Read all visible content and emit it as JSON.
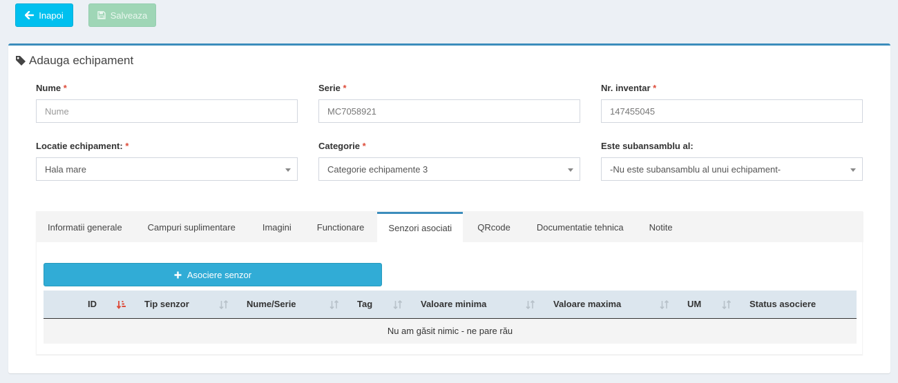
{
  "toolbar": {
    "back_label": "Inapoi",
    "save_label": "Salveaza"
  },
  "box": {
    "title": "Adauga echipament"
  },
  "form": {
    "nume": {
      "label": "Nume",
      "required": "*",
      "placeholder": "Nume",
      "value": ""
    },
    "serie": {
      "label": "Serie",
      "required": "*",
      "value": "MC7058921"
    },
    "inventar": {
      "label": "Nr. inventar",
      "required": "*",
      "value": "147455045"
    },
    "locatie": {
      "label": "Locatie echipament:",
      "required": "*",
      "value": "Hala mare"
    },
    "categorie": {
      "label": "Categorie",
      "required": "*",
      "value": "Categorie echipamente 3"
    },
    "subansamblu": {
      "label": "Este subansamblu al:",
      "value": "-Nu este subansamblu al unui echipament-"
    }
  },
  "tabs": [
    {
      "label": "Informatii generale"
    },
    {
      "label": "Campuri suplimentare"
    },
    {
      "label": "Imagini"
    },
    {
      "label": "Functionare"
    },
    {
      "label": "Senzori asociati",
      "active": true
    },
    {
      "label": "QRcode"
    },
    {
      "label": "Documentatie tehnica"
    },
    {
      "label": "Notite"
    }
  ],
  "sensors": {
    "associate_label": "Asociere senzor",
    "columns": [
      "ID",
      "Tip senzor",
      "Nume/Serie",
      "Tag",
      "Valoare minima",
      "Valoare maxima",
      "UM",
      "Status asociere"
    ],
    "empty_message": "Nu am găsit nimic - ne pare rău"
  },
  "colors": {
    "primary": "#3c8dbc",
    "info": "#00c0ef",
    "success_disabled": "#9fd6b6",
    "required": "#dd4b39",
    "sort_active": "#dd4b39"
  }
}
